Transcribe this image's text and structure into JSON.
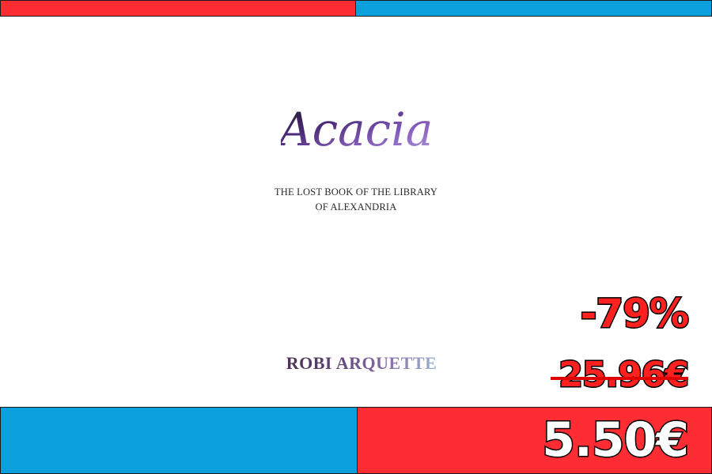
{
  "cover": {
    "title": "Acacia",
    "subtitle_line1": "THE LOST BOOK OF THE LIBRARY",
    "subtitle_line2": "OF ALEXANDRIA",
    "author": "ROBI ARQUETTE"
  },
  "price": {
    "discount": "-79%",
    "old_price": "25.96€",
    "new_price": "5.50€"
  },
  "colors": {
    "red": "#fe2c33",
    "blue": "#0ba0dc",
    "title_purple": "#5b2d82"
  }
}
